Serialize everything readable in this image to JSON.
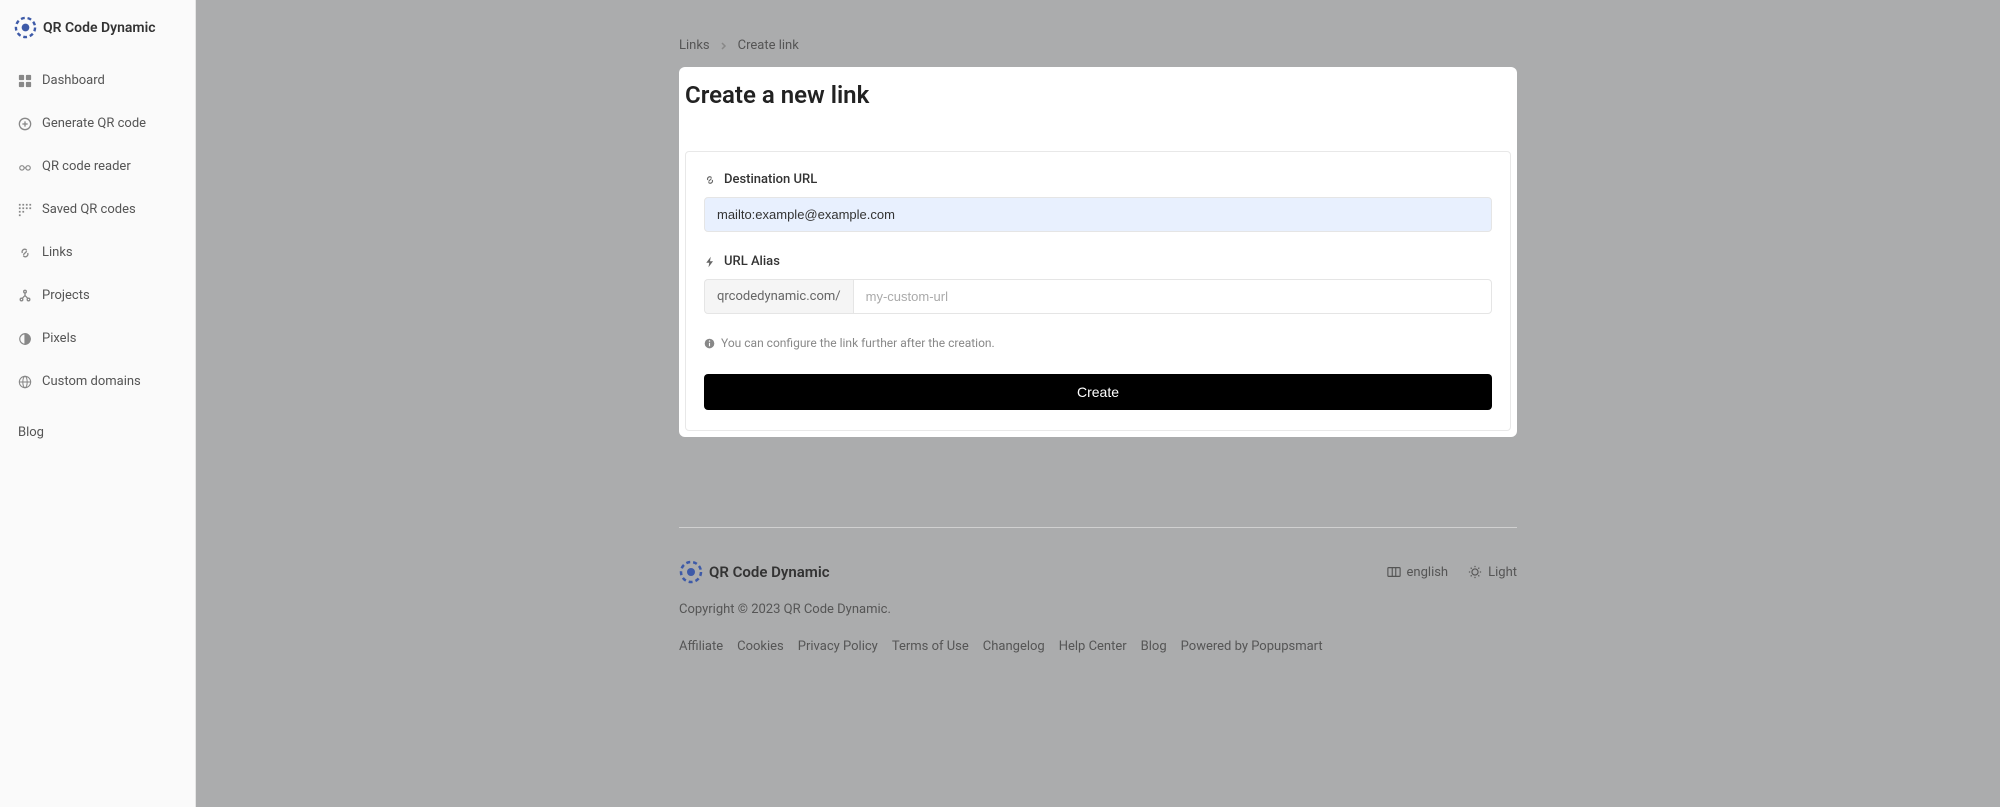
{
  "brand": {
    "name": "QR Code Dynamic"
  },
  "sidebar": {
    "items": [
      {
        "label": "Dashboard"
      },
      {
        "label": "Generate QR code"
      },
      {
        "label": "QR code reader"
      },
      {
        "label": "Saved QR codes"
      },
      {
        "label": "Links"
      },
      {
        "label": "Projects"
      },
      {
        "label": "Pixels"
      },
      {
        "label": "Custom domains"
      }
    ],
    "blog_label": "Blog"
  },
  "breadcrumb": {
    "links_label": "Links",
    "current_label": "Create link"
  },
  "page": {
    "title": "Create a new link"
  },
  "form": {
    "destination_label": "Destination URL",
    "destination_value": "mailto:example@example.com",
    "alias_label": "URL Alias",
    "alias_prefix": "qrcodedynamic.com/",
    "alias_placeholder": "my-custom-url",
    "info_text": "You can configure the link further after the creation.",
    "create_button": "Create"
  },
  "footer": {
    "brand": "QR Code Dynamic",
    "language": "english",
    "theme": "Light",
    "copyright": "Copyright © 2023 QR Code Dynamic.",
    "links": [
      "Affiliate",
      "Cookies",
      "Privacy Policy",
      "Terms of Use",
      "Changelog",
      "Help Center",
      "Blog",
      "Powered by Popupsmart"
    ]
  }
}
